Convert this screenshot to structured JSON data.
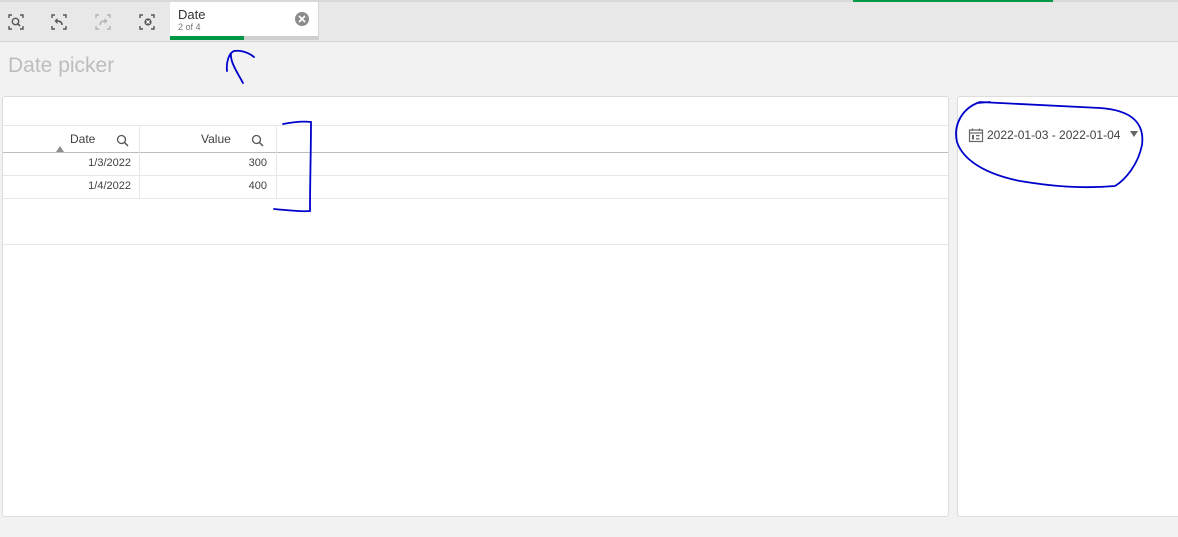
{
  "selection_bar": {
    "tools": [
      {
        "name": "smart-search-icon",
        "enabled": true
      },
      {
        "name": "step-back-icon",
        "enabled": true
      },
      {
        "name": "step-forward-icon",
        "enabled": false
      },
      {
        "name": "clear-all-icon",
        "enabled": true
      }
    ],
    "chip": {
      "title": "Date",
      "subtitle": "2 of 4",
      "selected_fraction": 0.5
    }
  },
  "sheet": {
    "title": "Date picker"
  },
  "table": {
    "columns": [
      {
        "label": "Date",
        "sort": "ascending"
      },
      {
        "label": "Value"
      }
    ],
    "rows": [
      {
        "date": "1/3/2022",
        "value": "300"
      },
      {
        "date": "1/4/2022",
        "value": "400"
      }
    ]
  },
  "date_picker": {
    "value": "2022-01-03 - 2022-01-04",
    "icon": "calendar-icon"
  },
  "colors": {
    "accent": "#009845",
    "annotation_ink": "#0000cc"
  }
}
